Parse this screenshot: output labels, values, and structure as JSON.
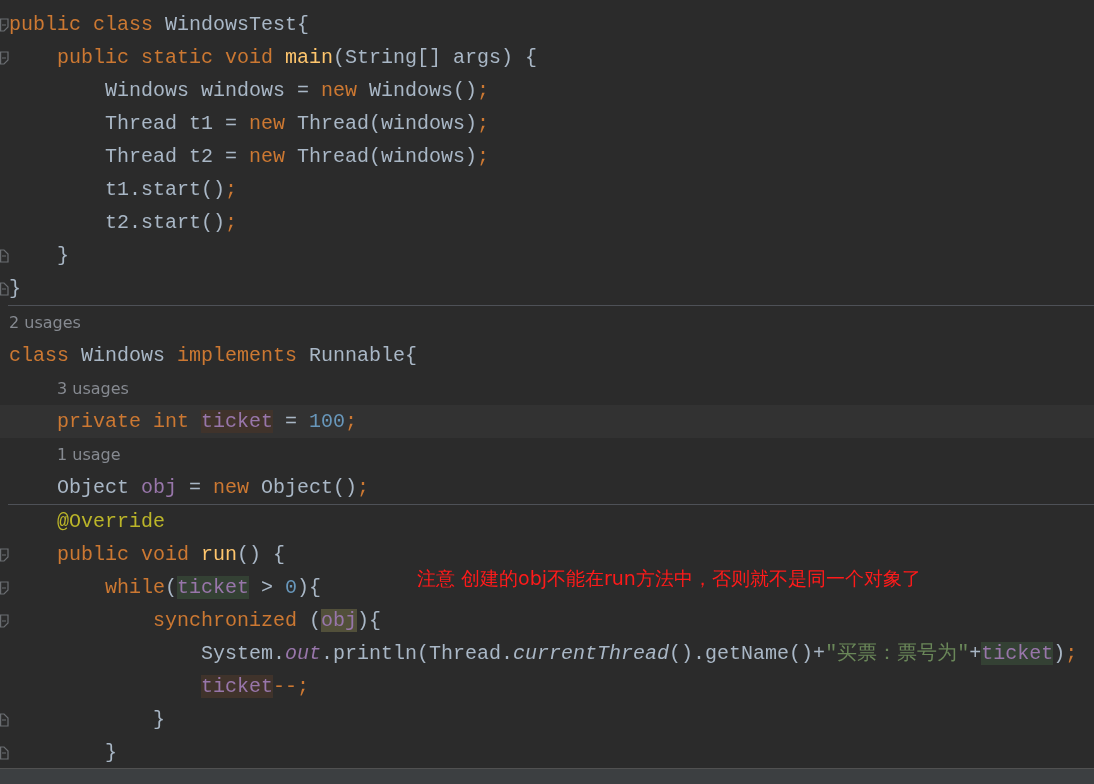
{
  "editor": {
    "lines": [
      {
        "kind": "fold-start",
        "tokens": [
          {
            "kind": "keyword",
            "text": "public class "
          },
          {
            "kind": "plain",
            "text": "WindowsTest{"
          }
        ],
        "children": [
          {
            "kind": "fold-start",
            "tokens": [
              {
                "kind": "keyword",
                "text": "public static void "
              },
              {
                "kind": "method",
                "text": "main"
              },
              {
                "kind": "plain",
                "text": "(String[] args) {"
              }
            ],
            "children": [
              {
                "kind": "code",
                "tokens": [
                  {
                    "kind": "plain",
                    "text": "Windows windows = "
                  },
                  {
                    "kind": "keyword",
                    "text": "new "
                  },
                  {
                    "kind": "plain",
                    "text": "Windows()"
                  },
                  {
                    "kind": "keyword",
                    "text": ";"
                  }
                ]
              },
              {
                "kind": "code",
                "tokens": [
                  {
                    "kind": "plain",
                    "text": "Thread t1 = "
                  },
                  {
                    "kind": "keyword",
                    "text": "new "
                  },
                  {
                    "kind": "plain",
                    "text": "Thread(windows)"
                  },
                  {
                    "kind": "keyword",
                    "text": ";"
                  }
                ]
              },
              {
                "kind": "code",
                "tokens": [
                  {
                    "kind": "plain",
                    "text": "Thread t2 = "
                  },
                  {
                    "kind": "keyword",
                    "text": "new "
                  },
                  {
                    "kind": "plain",
                    "text": "Thread(windows)"
                  },
                  {
                    "kind": "keyword",
                    "text": ";"
                  }
                ]
              },
              {
                "kind": "code",
                "tokens": [
                  {
                    "kind": "plain",
                    "text": "t1.start()"
                  },
                  {
                    "kind": "keyword",
                    "text": ";"
                  }
                ]
              },
              {
                "kind": "code",
                "tokens": [
                  {
                    "kind": "plain",
                    "text": "t2.start()"
                  },
                  {
                    "kind": "keyword",
                    "text": ";"
                  }
                ]
              }
            ]
          },
          {
            "kind": "fold-end",
            "tokens": [
              {
                "kind": "plain",
                "text": "}"
              }
            ]
          }
        ]
      },
      {
        "kind": "fold-end",
        "tokens": [
          {
            "kind": "plain",
            "text": "}"
          }
        ]
      },
      {
        "kind": "separator"
      },
      {
        "kind": "usage",
        "text": "2 usages"
      },
      {
        "kind": "code",
        "tokens": [
          {
            "kind": "keyword",
            "text": "class "
          },
          {
            "kind": "plain",
            "text": "Windows "
          },
          {
            "kind": "keyword",
            "text": "implements "
          },
          {
            "kind": "plain",
            "text": "Runnable{"
          }
        ],
        "children": [
          {
            "kind": "usage",
            "text": "3 usages"
          },
          {
            "kind": "code",
            "current": true,
            "tokens": [
              {
                "kind": "keyword",
                "text": "private int "
              },
              {
                "kind": "field-write",
                "text": "ticket"
              },
              {
                "kind": "plain",
                "text": " = "
              },
              {
                "kind": "number",
                "text": "100"
              },
              {
                "kind": "keyword",
                "text": ";"
              }
            ]
          },
          {
            "kind": "usage",
            "text": "1 usage"
          },
          {
            "kind": "code",
            "tokens": [
              {
                "kind": "plain",
                "text": "Object "
              },
              {
                "kind": "field",
                "text": "obj"
              },
              {
                "kind": "plain",
                "text": " = "
              },
              {
                "kind": "keyword",
                "text": "new "
              },
              {
                "kind": "plain",
                "text": "Object()"
              },
              {
                "kind": "keyword",
                "text": ";"
              }
            ]
          },
          {
            "kind": "separator"
          },
          {
            "kind": "code",
            "tokens": [
              {
                "kind": "annotation",
                "text": "@Override"
              }
            ]
          },
          {
            "kind": "fold-start",
            "tokens": [
              {
                "kind": "keyword",
                "text": "public void "
              },
              {
                "kind": "method",
                "text": "run"
              },
              {
                "kind": "plain",
                "text": "() {"
              }
            ],
            "children": [
              {
                "kind": "fold-start",
                "tokens": [
                  {
                    "kind": "keyword",
                    "text": "while"
                  },
                  {
                    "kind": "plain",
                    "text": "("
                  },
                  {
                    "kind": "field-read",
                    "text": "ticket"
                  },
                  {
                    "kind": "plain",
                    "text": " > "
                  },
                  {
                    "kind": "number",
                    "text": "0"
                  },
                  {
                    "kind": "plain",
                    "text": "){"
                  }
                ],
                "children": [
                  {
                    "kind": "fold-start",
                    "tokens": [
                      {
                        "kind": "keyword",
                        "text": "synchronized "
                      },
                      {
                        "kind": "plain",
                        "text": "("
                      },
                      {
                        "kind": "field-target",
                        "text": "obj"
                      },
                      {
                        "kind": "plain",
                        "text": "){"
                      }
                    ],
                    "children": [
                      {
                        "kind": "code",
                        "tokens": [
                          {
                            "kind": "plain",
                            "text": "System."
                          },
                          {
                            "kind": "static-field",
                            "text": "out"
                          },
                          {
                            "kind": "plain",
                            "text": ".println(Thread."
                          },
                          {
                            "kind": "static-method",
                            "text": "currentThread"
                          },
                          {
                            "kind": "plain",
                            "text": "().getName()+"
                          },
                          {
                            "kind": "string",
                            "text": "\"买票：票号为\""
                          },
                          {
                            "kind": "plain",
                            "text": "+"
                          },
                          {
                            "kind": "field-read",
                            "text": "ticket"
                          },
                          {
                            "kind": "plain",
                            "text": ")"
                          },
                          {
                            "kind": "keyword",
                            "text": ";"
                          }
                        ]
                      },
                      {
                        "kind": "code",
                        "tokens": [
                          {
                            "kind": "field-write",
                            "text": "ticket"
                          },
                          {
                            "kind": "keyword",
                            "text": "--;"
                          }
                        ]
                      }
                    ]
                  },
                  {
                    "kind": "fold-end",
                    "tokens": [
                      {
                        "kind": "plain",
                        "text": "}"
                      }
                    ]
                  }
                ]
              },
              {
                "kind": "fold-end",
                "tokens": [
                  {
                    "kind": "plain",
                    "text": "}"
                  }
                ]
              }
            ]
          }
        ]
      }
    ],
    "note": "注意 创建的obj不能在run方法中，否则就不是同一个对象了"
  }
}
